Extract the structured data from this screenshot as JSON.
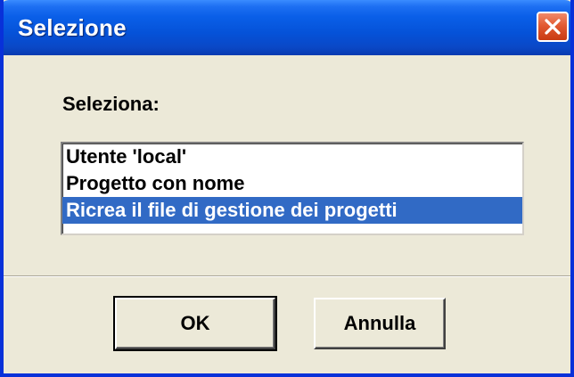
{
  "window": {
    "title": "Selezione",
    "close_icon": "close-icon"
  },
  "dialog": {
    "prompt": "Seleziona:",
    "options": [
      {
        "label": "Utente 'local'",
        "selected": false
      },
      {
        "label": "Progetto con nome",
        "selected": false
      },
      {
        "label": "Ricrea il file di gestione dei progetti",
        "selected": true
      }
    ]
  },
  "buttons": {
    "ok_label": "OK",
    "cancel_label": "Annulla"
  },
  "colors": {
    "titlebar": "#0552d8",
    "selection": "#316ac5",
    "close": "#e25a32",
    "dialog_bg": "#ece9d8"
  }
}
